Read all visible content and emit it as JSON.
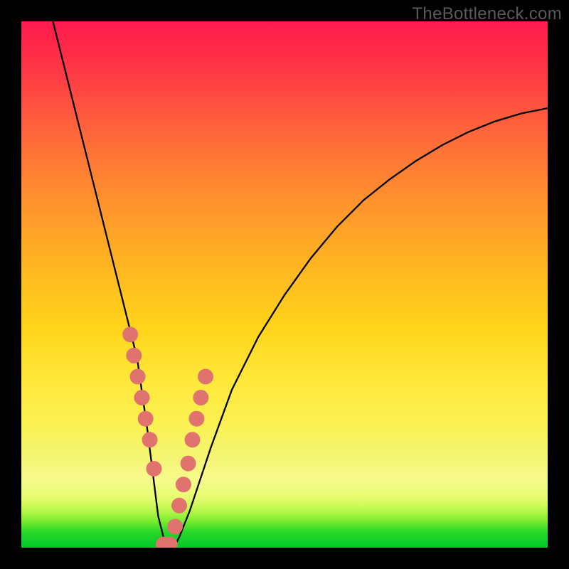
{
  "watermark": {
    "text": "TheBottleneck.com"
  },
  "chart_data": {
    "type": "line",
    "title": "",
    "xlabel": "",
    "ylabel": "",
    "xlim": [
      0,
      100
    ],
    "ylim": [
      0,
      100
    ],
    "series": [
      {
        "name": "bottleneck-curve",
        "x": [
          6,
          8,
          10,
          12,
          14,
          16,
          18,
          20,
          22,
          24,
          25,
          26,
          27,
          28,
          29,
          30,
          32,
          34,
          36,
          40,
          45,
          50,
          55,
          60,
          65,
          70,
          75,
          80,
          85,
          90,
          95,
          100
        ],
        "y": [
          100,
          92,
          84,
          76,
          68,
          60,
          52,
          44,
          36,
          22,
          14,
          6,
          2,
          0,
          0,
          2,
          7,
          13,
          19,
          30,
          40,
          48,
          55,
          61,
          66,
          70,
          73.5,
          76.5,
          79,
          81,
          82.5,
          83.5
        ]
      }
    ],
    "markers": {
      "name": "highlighted-points",
      "color": "#e0736d",
      "radius_px": 11,
      "x": [
        20.7,
        21.4,
        22.1,
        22.9,
        23.6,
        24.4,
        25.2,
        27.0,
        28.2,
        29.2,
        30.0,
        30.8,
        31.7,
        32.5,
        33.3,
        34.1,
        35.0
      ],
      "y": [
        40.5,
        36.5,
        32.5,
        28.5,
        24.5,
        20.5,
        15.0,
        0.6,
        0.6,
        4.0,
        8.0,
        12.0,
        16.0,
        20.5,
        24.5,
        28.5,
        32.5
      ]
    },
    "grid": false,
    "legend": false
  }
}
